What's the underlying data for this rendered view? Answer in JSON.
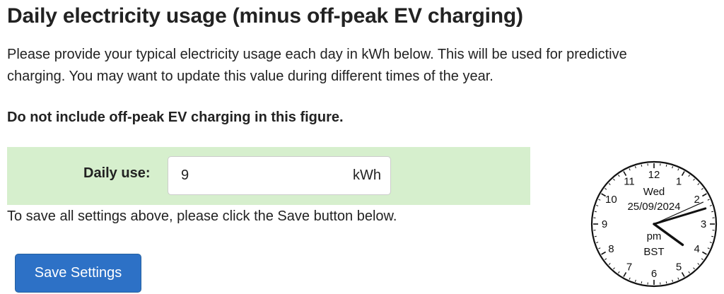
{
  "section": {
    "title": "Daily electricity usage (minus off-peak EV charging)",
    "description": "Please provide your typical electricity usage each day in kWh below. This will be used for predictive charging. You may want to update this value during different times of the year.",
    "warning": "Do not include off-peak EV charging in this figure."
  },
  "form": {
    "daily_use_label": "Daily use:",
    "daily_use_value": "9",
    "unit": "kWh"
  },
  "save": {
    "note": "To save all settings above, please click the Save button below.",
    "button_label": "Save Settings"
  },
  "clock": {
    "day": "Wed",
    "date": "25/09/2024",
    "meridiem": "pm",
    "timezone": "BST",
    "hour": 4,
    "minute": 12,
    "second": 11,
    "numbers": [
      "12",
      "1",
      "2",
      "3",
      "4",
      "5",
      "6",
      "7",
      "8",
      "9",
      "10",
      "11"
    ]
  },
  "colors": {
    "form_band": "#d6efcd",
    "button": "#2d71c6",
    "text": "#222222"
  }
}
